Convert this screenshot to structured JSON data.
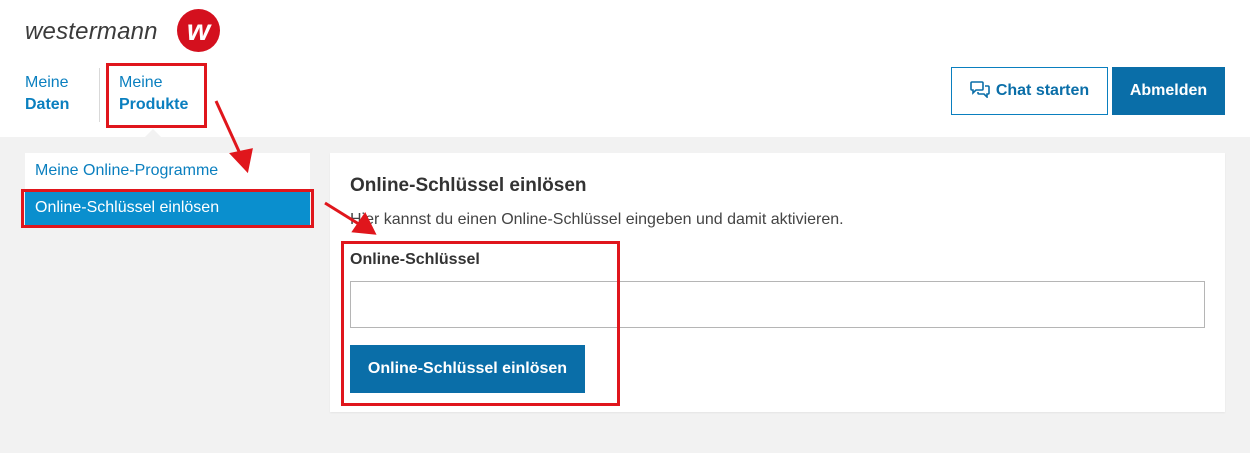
{
  "brand": {
    "wordmark": "westermann",
    "logo_letter": "w",
    "accent_color": "#d4101e"
  },
  "nav": {
    "items": [
      {
        "line1": "Meine",
        "line2": "Daten"
      },
      {
        "line1": "Meine",
        "line2": "Produkte"
      }
    ]
  },
  "header_buttons": {
    "chat_label": "Chat starten",
    "chat_icon": "chat-bubbles-icon",
    "logout_label": "Abmelden"
  },
  "sidebar": {
    "items": [
      {
        "label": "Meine Online-Programme",
        "active": false
      },
      {
        "label": "Online-Schlüssel einlösen",
        "active": true
      }
    ]
  },
  "panel": {
    "title": "Online-Schlüssel einlösen",
    "description": "Hier kannst du einen Online-Schlüssel eingeben und damit aktivieren.",
    "field_label": "Online-Schlüssel",
    "field_value": "",
    "submit_label": "Online-Schlüssel einlösen"
  },
  "colors": {
    "primary": "#0a6ea8",
    "link": "#0a7fbf",
    "active_bg": "#0a8fce",
    "annotation": "#e0161c"
  }
}
